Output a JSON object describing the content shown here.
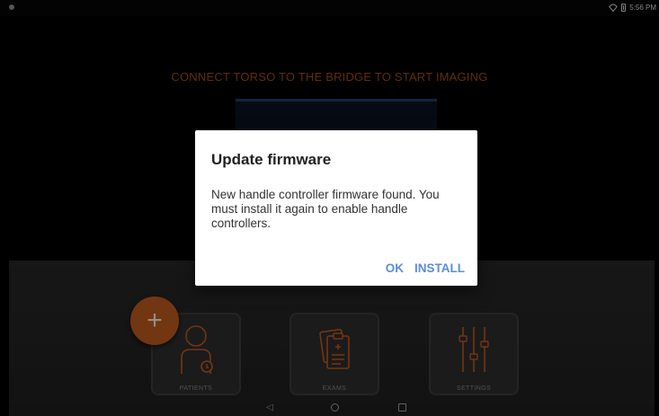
{
  "status_bar": {
    "time": "5:56 PM"
  },
  "app": {
    "prompt": "CONNECT TORSO TO THE BRIDGE TO START IMAGING",
    "tiles": [
      {
        "label": "PATIENTS",
        "icon": "patient-icon"
      },
      {
        "label": "EXAMS",
        "icon": "clipboard-icon"
      },
      {
        "label": "SETTINGS",
        "icon": "sliders-icon"
      }
    ],
    "fab_symbol": "+"
  },
  "dialog": {
    "title": "Update firmware",
    "message": "New handle controller firmware found. You must install it again to enable handle controllers.",
    "ok_label": "OK",
    "install_label": "INSTALL"
  },
  "colors": {
    "accent": "#b8571d",
    "prompt_text": "#9a4a12",
    "dialog_button": "#5b8fd6"
  }
}
